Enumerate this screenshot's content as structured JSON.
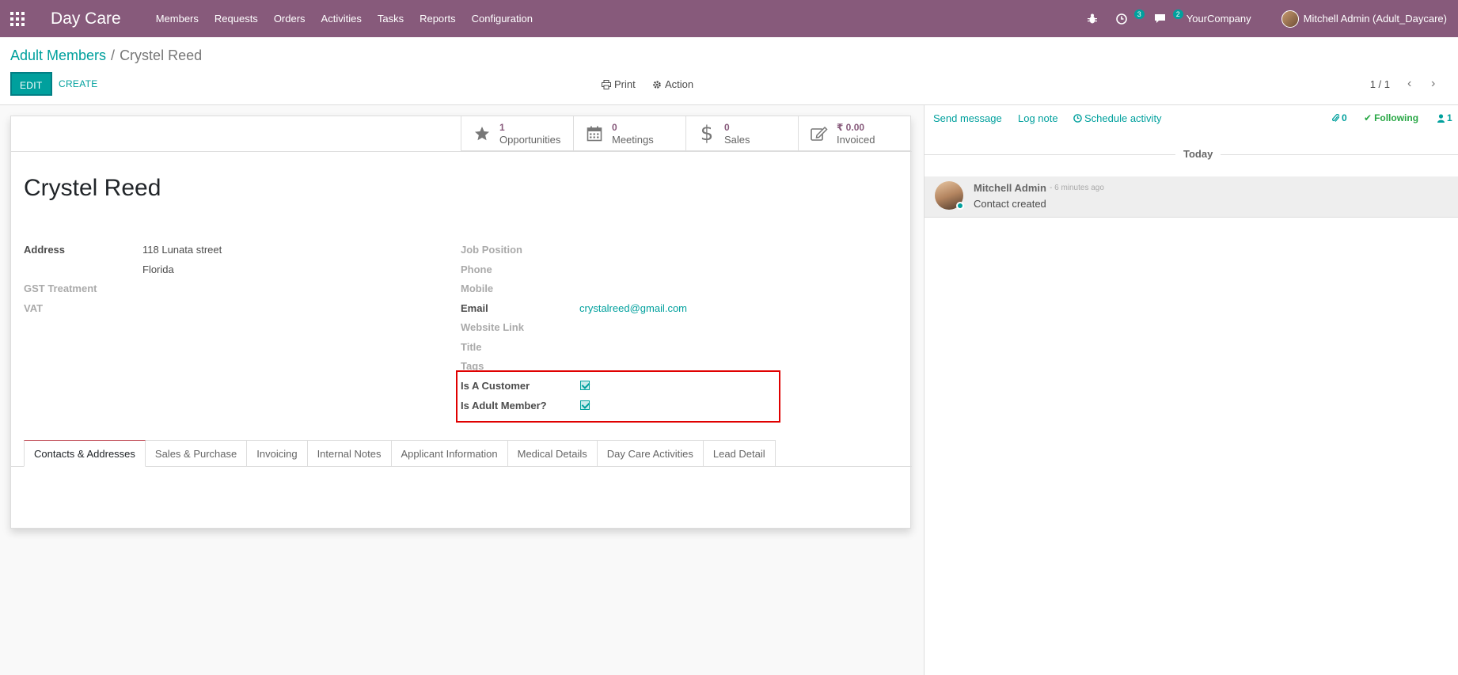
{
  "navbar": {
    "app_name": "Day Care",
    "menu": [
      "Members",
      "Requests",
      "Orders",
      "Activities",
      "Tasks",
      "Reports",
      "Configuration"
    ],
    "activity_badge": "3",
    "messages_badge": "2",
    "company": "YourCompany",
    "user": "Mitchell Admin (Adult_Daycare)",
    "color": "#875a7b"
  },
  "breadcrumb": {
    "parent": "Adult Members",
    "separator": "/",
    "current": "Crystel Reed"
  },
  "control": {
    "edit": "EDIT",
    "create": "CREATE",
    "print": "Print",
    "action": "Action",
    "pager": "1 / 1"
  },
  "stat_buttons": [
    {
      "value": "1",
      "label": "Opportunities",
      "icon": "star-icon"
    },
    {
      "value": "0",
      "label": "Meetings",
      "icon": "calendar-icon"
    },
    {
      "value": "0",
      "label": "Sales",
      "icon": "dollar-icon"
    },
    {
      "value": "₹ 0.00",
      "label": "Invoiced",
      "icon": "edit-icon"
    }
  ],
  "record": {
    "name": "Crystel Reed",
    "address_label": "Address",
    "address_line1": "118 Lunata street",
    "address_line2": "Florida",
    "gst_label": "GST Treatment",
    "vat_label": "VAT",
    "job_label": "Job Position",
    "phone_label": "Phone",
    "mobile_label": "Mobile",
    "email_label": "Email",
    "email": "crystalreed@gmail.com",
    "website_label": "Website Link",
    "title_label": "Title",
    "tags_label": "Tags",
    "customer_label": "Is A Customer",
    "is_customer": true,
    "adult_label": "Is Adult Member?",
    "is_adult_member": true
  },
  "tabs": [
    "Contacts & Addresses",
    "Sales & Purchase",
    "Invoicing",
    "Internal Notes",
    "Applicant Information",
    "Medical Details",
    "Day Care Activities",
    "Lead Detail"
  ],
  "chatter": {
    "send_message": "Send message",
    "log_note": "Log note",
    "schedule_activity": "Schedule activity",
    "attachments": "0",
    "following": "Following",
    "followers": "1",
    "today": "Today",
    "message": {
      "author": "Mitchell Admin",
      "time": "- 6 minutes ago",
      "body": "Contact created"
    }
  }
}
